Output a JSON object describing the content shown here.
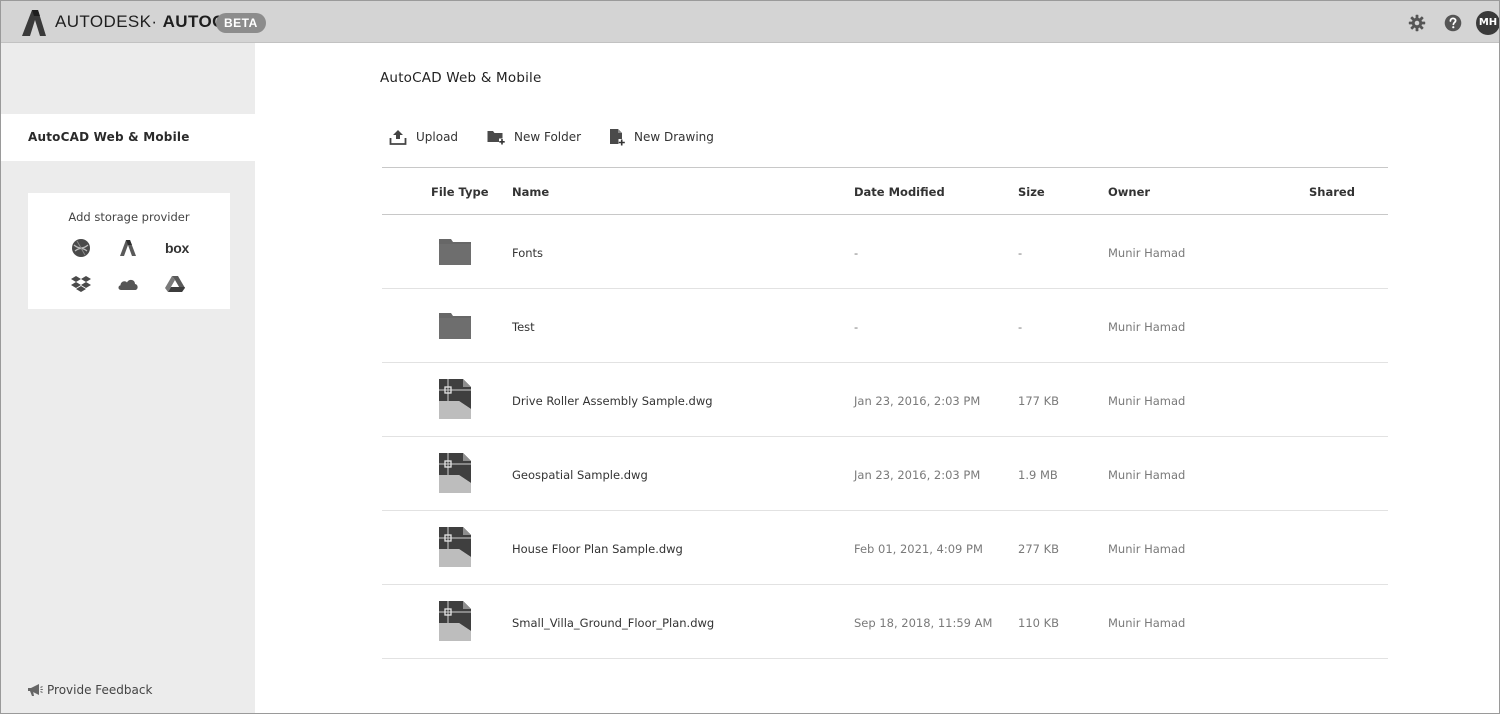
{
  "topbar": {
    "brand_primary": "AUTODESK·",
    "brand_secondary": "AUTOCAD·",
    "badge": "BETA",
    "icons": [
      "settings-gear-icon",
      "help-icon"
    ],
    "user_initials": "MH"
  },
  "sidebar": {
    "active_item": "AutoCAD Web & Mobile",
    "storage_title": "Add storage provider",
    "providers": [
      "webdav-globe-icon",
      "autodesk-docs-icon",
      "box-icon",
      "dropbox-icon",
      "onedrive-icon",
      "google-drive-icon"
    ],
    "box_label": "box",
    "feedback": "Provide Feedback"
  },
  "main": {
    "title": "AutoCAD Web & Mobile",
    "actions": [
      {
        "label": "Upload",
        "icon": "upload-icon"
      },
      {
        "label": "New Folder",
        "icon": "new-folder-icon"
      },
      {
        "label": "New Drawing",
        "icon": "new-drawing-icon"
      }
    ],
    "columns": [
      "File Type",
      "Name",
      "Date Modified",
      "Size",
      "Owner",
      "Shared"
    ],
    "rows": [
      {
        "type": "folder",
        "name": "Fonts",
        "date": "-",
        "size": "-",
        "owner": "Munir Hamad",
        "shared": ""
      },
      {
        "type": "folder",
        "name": "Test",
        "date": "-",
        "size": "-",
        "owner": "Munir Hamad",
        "shared": ""
      },
      {
        "type": "dwg",
        "name": "Drive Roller Assembly Sample.dwg",
        "date": "Jan 23, 2016, 2:03 PM",
        "size": "177 KB",
        "owner": "Munir Hamad",
        "shared": ""
      },
      {
        "type": "dwg",
        "name": "Geospatial Sample.dwg",
        "date": "Jan 23, 2016, 2:03 PM",
        "size": "1.9 MB",
        "owner": "Munir Hamad",
        "shared": ""
      },
      {
        "type": "dwg",
        "name": "House Floor Plan Sample.dwg",
        "date": "Feb 01, 2021, 4:09 PM",
        "size": "277 KB",
        "owner": "Munir Hamad",
        "shared": ""
      },
      {
        "type": "dwg",
        "name": "Small_Villa_Ground_Floor_Plan.dwg",
        "date": "Sep 18, 2018, 11:59 AM",
        "size": "110 KB",
        "owner": "Munir Hamad",
        "shared": ""
      }
    ]
  }
}
